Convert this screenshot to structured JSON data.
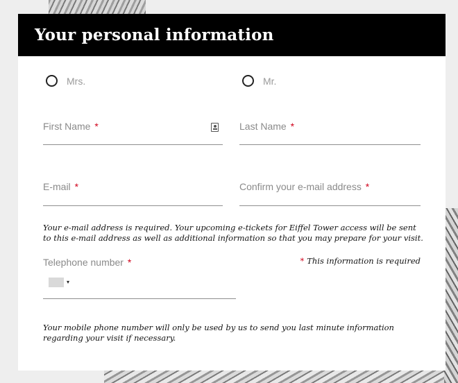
{
  "form": {
    "title": "Your personal information",
    "salutations": [
      "Mrs.",
      "Mr."
    ],
    "fields": {
      "first_name": {
        "label": "First Name",
        "required_mark": "*",
        "value": ""
      },
      "last_name": {
        "label": "Last Name",
        "required_mark": "*",
        "value": ""
      },
      "email": {
        "label": "E-mail",
        "required_mark": "*",
        "value": ""
      },
      "confirm_email": {
        "label": "Confirm your e-mail address",
        "required_mark": "*",
        "value": ""
      },
      "telephone": {
        "label": "Telephone number",
        "required_mark": "*",
        "value": ""
      }
    },
    "email_note": "Your e-mail address is required. Your upcoming e-tickets for Eiffel Tower access will be sent to this e-mail address as well as additional information so that you may prepare for your visit.",
    "required_note": {
      "mark": "*",
      "text": "This information is required"
    },
    "phone_note": "Your mobile phone number will only be used by us to send you last minute information regarding your visit if necessary.",
    "country_dropdown_caret": "▾"
  },
  "colors": {
    "header_bg": "#000000",
    "header_text": "#ffffff",
    "required": "#d0021b",
    "label": "#8a8a8a"
  },
  "icons": {
    "contact_card": "contact-card-icon",
    "radio": "radio-unchecked-icon",
    "flag": "country-flag-icon"
  }
}
